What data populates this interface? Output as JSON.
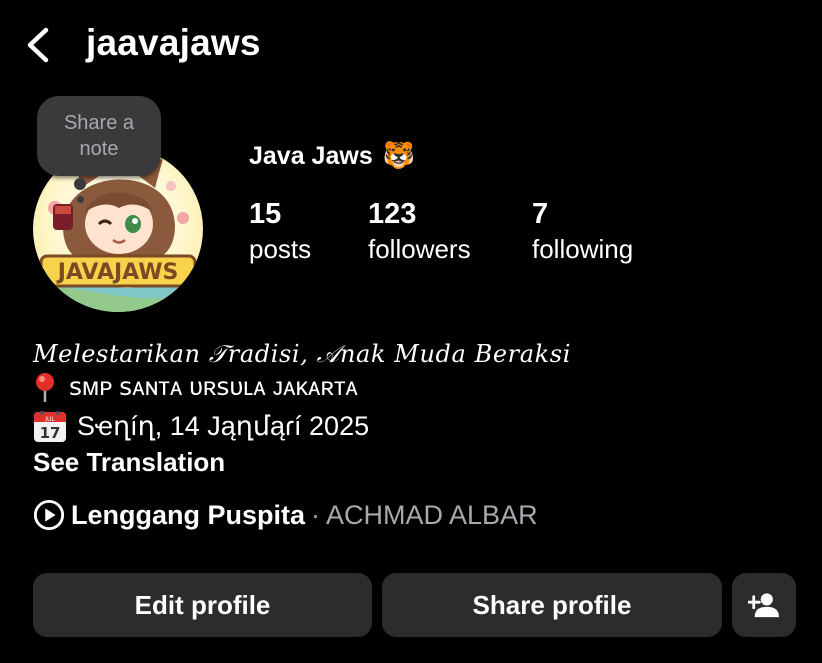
{
  "header": {
    "username": "jaavajaws"
  },
  "profile": {
    "note_label": "Share a note",
    "display_name": "Java Jaws",
    "name_emoji": "🐯",
    "avatar_text": "JAVAJAWS"
  },
  "stats": [
    {
      "count": "15",
      "label": "posts"
    },
    {
      "count": "123",
      "label": "followers"
    },
    {
      "count": "7",
      "label": "following"
    }
  ],
  "bio": {
    "tagline": "𝑀𝑒𝑙𝑒𝑠𝑡𝑎𝑟𝑖𝑘𝑎𝑛 𝒯𝑟𝑎𝑑𝑖𝑠𝑖, 𝒜𝑛𝑎𝑘 𝑀𝑢𝑑𝑎 𝐵𝑒𝑟𝑎𝑘𝑠𝑖",
    "location": "ꜱᴍᴘ ꜱᴀɴᴛᴀ ᴜʀꜱᴜʟᴀ ᴊᴀᴋᴀʀᴛᴀ",
    "date": "Ѕҽղíղ, 14 Jąղմąɾí 2025",
    "calendar_badge": "JUL",
    "calendar_day": "17",
    "see_translation": "See Translation"
  },
  "music": {
    "song": "Lenggang Puspita",
    "separator": "·",
    "artist": "ACHMAD ALBAR"
  },
  "buttons": {
    "edit": "Edit profile",
    "share": "Share profile"
  },
  "icons": {
    "back": "chevron-left-icon",
    "location": "round-pushpin-icon",
    "calendar": "calendar-icon",
    "music": "play-circle-icon",
    "add_person": "add-person-icon"
  },
  "colors": {
    "background": "#000000",
    "button_bg": "#2c2c2e",
    "note_bg": "#3a3a3c",
    "muted_text": "#a8a8ad"
  }
}
